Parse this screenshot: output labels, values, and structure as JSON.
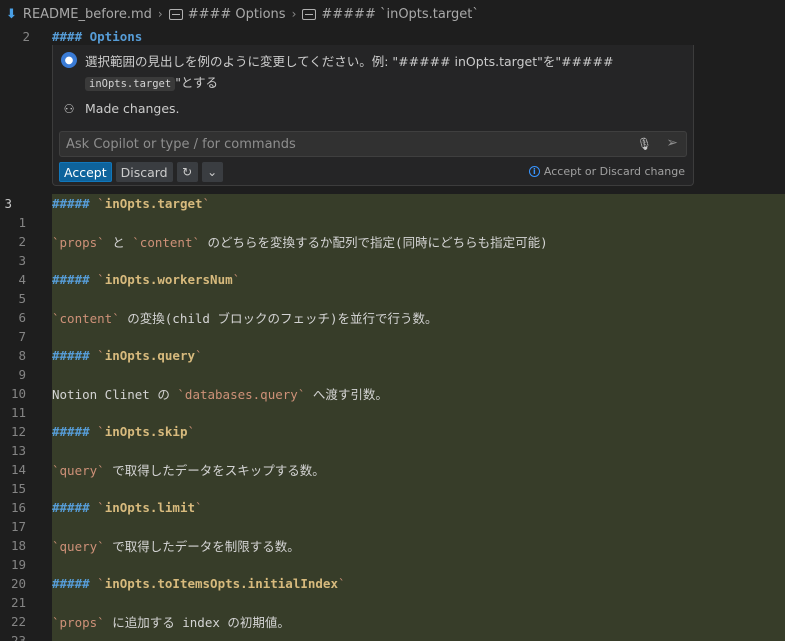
{
  "breadcrumb": {
    "file": "README_before.md",
    "section1": "#### Options",
    "section2": "##### `inOpts.target`"
  },
  "top_line": {
    "num": "2",
    "text": "#### Options"
  },
  "chat": {
    "message_line1": "選択範囲の見出しを例のように変更してください。例: \"##### inOpts.target\"を\"#####",
    "message_chip": "inOpts.target",
    "message_line2_end": "\"とする",
    "made_changes": "Made changes.",
    "input_placeholder": "Ask Copilot or type / for commands",
    "accept_label": "Accept",
    "discard_label": "Discard",
    "hint": "Accept or Discard change",
    "colors": {
      "accent": "#0e639c",
      "diff_bg": "#373d29"
    }
  },
  "editor": {
    "lines": [
      {
        "num": "3",
        "h": "#####",
        "id": "inOpts.target"
      },
      {
        "num": "1"
      },
      {
        "num": "2",
        "pre": "",
        "code": "props",
        "mid": " と ",
        "code2": "content",
        "post": " のどちらを変換するか配列で指定(同時にどちらも指定可能)"
      },
      {
        "num": "3"
      },
      {
        "num": "4",
        "h": "#####",
        "id": "inOpts.workersNum"
      },
      {
        "num": "5"
      },
      {
        "num": "6",
        "code": "content",
        "post": " の変換(child ブロックのフェッチ)を並行で行う数。"
      },
      {
        "num": "7"
      },
      {
        "num": "8",
        "h": "#####",
        "id": "inOpts.query"
      },
      {
        "num": "9"
      },
      {
        "num": "10",
        "pre": "Notion Clinet の ",
        "code": "databases.query",
        "post": " へ渡す引数。"
      },
      {
        "num": "11"
      },
      {
        "num": "12",
        "h": "#####",
        "id": "inOpts.skip"
      },
      {
        "num": "13"
      },
      {
        "num": "14",
        "code": "query",
        "post": " で取得したデータをスキップする数。"
      },
      {
        "num": "15"
      },
      {
        "num": "16",
        "h": "#####",
        "id": "inOpts.limit"
      },
      {
        "num": "17"
      },
      {
        "num": "18",
        "code": "query",
        "post": " で取得したデータを制限する数。"
      },
      {
        "num": "19"
      },
      {
        "num": "20",
        "h": "#####",
        "id": "inOpts.toItemsOpts.initialIndex"
      },
      {
        "num": "21"
      },
      {
        "num": "22",
        "code": "props",
        "post": " に追加する index の初期値。"
      },
      {
        "num": "23"
      }
    ]
  }
}
